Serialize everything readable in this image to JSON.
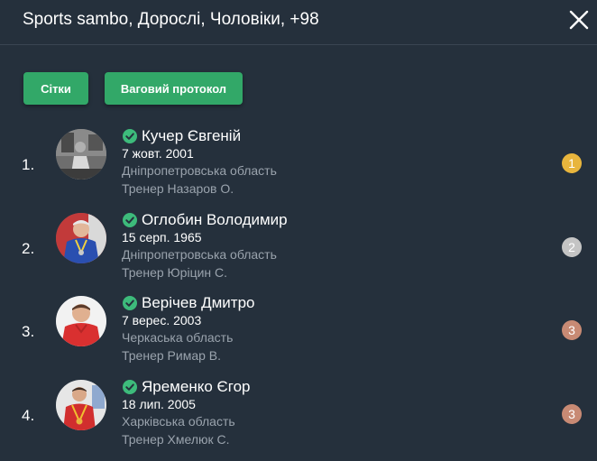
{
  "modal": {
    "title": "Sports sambo, Дорослі, Чоловіки, +98",
    "close_icon": "close-icon"
  },
  "actions": {
    "grids_label": "Сітки",
    "weigh_in_label": "Ваговий протокол"
  },
  "colors": {
    "background": "#25303c",
    "button": "#32a868",
    "verified": "#3dbb7b",
    "gold": "#e8b53d",
    "silver": "#c4c4c4",
    "bronze": "#c88a74"
  },
  "athletes": [
    {
      "rank": "1.",
      "name": "Кучер Євгеній",
      "dob": "7 жовт. 2001",
      "region": "Дніпропетровська область",
      "coach": "Тренер Назаров О.",
      "place": "1",
      "medal": "gold",
      "verified_icon": "check-circle-icon"
    },
    {
      "rank": "2.",
      "name": "Оглобин Володимир",
      "dob": "15 серп. 1965",
      "region": "Дніпропетровська область",
      "coach": "Тренер Юріцин С.",
      "place": "2",
      "medal": "silver",
      "verified_icon": "check-circle-icon"
    },
    {
      "rank": "3.",
      "name": "Верічев Дмитро",
      "dob": "7 верес. 2003",
      "region": "Черкаська область",
      "coach": "Тренер Римар В.",
      "place": "3",
      "medal": "bronze",
      "verified_icon": "check-circle-icon"
    },
    {
      "rank": "4.",
      "name": "Яременко Єгор",
      "dob": "18 лип. 2005",
      "region": "Харківська область",
      "coach": "Тренер Хмелюк С.",
      "place": "3",
      "medal": "bronze",
      "verified_icon": "check-circle-icon"
    }
  ]
}
